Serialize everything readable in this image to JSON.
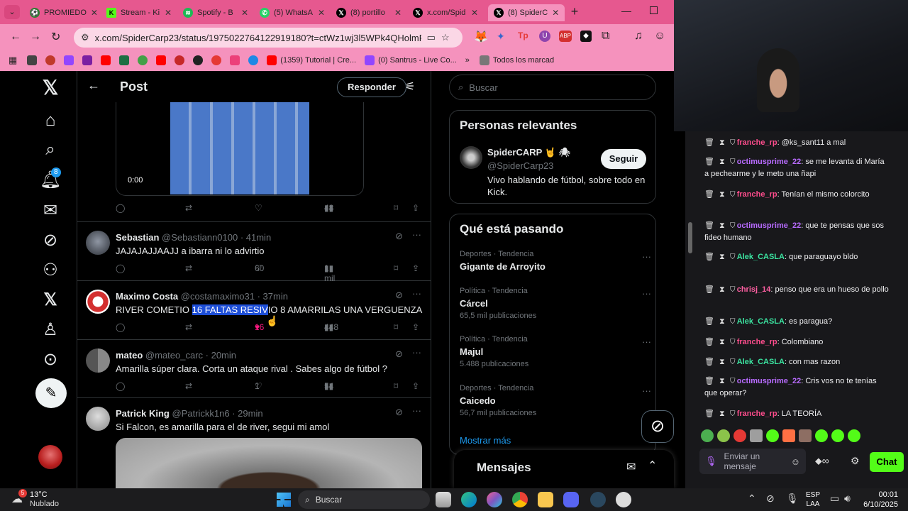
{
  "tabs": [
    {
      "label": "PROMIEDO",
      "color": "#2e7d32",
      "active": false
    },
    {
      "label": "Stream - Ki",
      "color": "#53fc18",
      "active": false
    },
    {
      "label": "Spotify - B",
      "color": "#1db954",
      "active": false
    },
    {
      "label": "(5) WhatsA",
      "color": "#25d366",
      "active": false
    },
    {
      "label": "(8) portillo",
      "color": "#000000",
      "active": false
    },
    {
      "label": "x.com/Spid",
      "color": "#000000",
      "active": false
    },
    {
      "label": "(8) SpiderC",
      "color": "#000000",
      "active": true
    }
  ],
  "url": "x.com/SpiderCarp23/status/1975022764122919180?t=ctWz1wj3l5WPk4QHolmRsg&s=19",
  "bookmarks": {
    "item1": "(1359) Tutorial | Cre...",
    "item2": "(0) Santrus - Live Co...",
    "all": "Todos los marcad"
  },
  "x": {
    "header_title": "Post",
    "reply_button": "Responder",
    "notif_count": "8",
    "video_time": "0:00",
    "video_views": "48",
    "search_placeholder": "Buscar",
    "tweets": [
      {
        "name": "Sebastian",
        "handle": "@Sebastiann0100 · 41min",
        "text": "JAJAJAJJAAJJ a ibarra ni lo advirtio",
        "likes": "60",
        "views": "1 mil"
      },
      {
        "name": "Maximo Costa",
        "handle": "@costamaximo31 · 37min",
        "text_a": "RIVER COMETIO ",
        "text_hl": "16 FALTAS RESIV",
        "text_b": "IO 8 AMARRILAS UNA VERGUENZA",
        "likes": "16",
        "views": "448"
      },
      {
        "name": "mateo",
        "handle": "@mateo_carc · 20min",
        "text": "Amarilla súper clara. Corta un ataque rival . Sabes algo de fútbol ?",
        "likes": "1",
        "views": "54"
      },
      {
        "name": "Patrick King",
        "handle": "@Patrickk1n6 · 29min",
        "text": "Si Falcon, es amarilla para el de river, segui mi amol"
      }
    ],
    "relevant": {
      "title": "Personas relevantes",
      "name": "SpiderCARP",
      "handle": "@SpiderCarp23",
      "follow": "Seguir",
      "bio": "Vivo hablando de fútbol, sobre todo en Kick."
    },
    "trends_title": "Qué está pasando",
    "trends": [
      {
        "cat": "Deportes · Tendencia",
        "name": "Gigante de Arroyito",
        "posts": ""
      },
      {
        "cat": "Política · Tendencia",
        "name": "Cárcel",
        "posts": "65,5 mil publicaciones"
      },
      {
        "cat": "Política · Tendencia",
        "name": "Majul",
        "posts": "5.488 publicaciones"
      },
      {
        "cat": "Deportes · Tendencia",
        "name": "Caicedo",
        "posts": "56,7 mil publicaciones"
      }
    ],
    "show_more": "Mostrar más",
    "messages": "Mensajes"
  },
  "chat": {
    "messages": [
      {
        "user": "franche_rp",
        "color": "#ff4d8d",
        "text": ": @ks_sant11 a mal"
      },
      {
        "user": "octimusprime_22",
        "color": "#b86bff",
        "text": ": se me levanta di María a pechearme y le meto una ñapi"
      },
      {
        "user": "franche_rp",
        "color": "#ff4d8d",
        "text": ": Tenían el mismo colorcito"
      },
      {
        "user": "octimusprime_22",
        "color": "#b86bff",
        "text": ": que te pensas que sos fideo humano"
      },
      {
        "user": "Alek_CASLA",
        "color": "#3be3a0",
        "text": ": que paraguayo bldo"
      },
      {
        "user": "chrisj_14",
        "color": "#ff5fa2",
        "text": ": penso que era un hueso de pollo"
      },
      {
        "user": "Alek_CASLA",
        "color": "#3be3a0",
        "text": ": es paragua?"
      },
      {
        "user": "franche_rp",
        "color": "#ff4d8d",
        "text": ": Colombiano"
      },
      {
        "user": "Alek_CASLA",
        "color": "#3be3a0",
        "text": ": con mas razon"
      },
      {
        "user": "octimusprime_22",
        "color": "#b86bff",
        "text": ": Cris vos no te tenías que operar?"
      },
      {
        "user": "franche_rp",
        "color": "#ff4d8d",
        "text": ": LA TEORÍA"
      }
    ],
    "placeholder": "Enviar un mensaje",
    "send": "Chat"
  },
  "taskbar": {
    "temp": "13°C",
    "weather": "Nublado",
    "weather_badge": "5",
    "search": "Buscar",
    "lang1": "ESP",
    "lang2": "LAA",
    "time": "00:01",
    "date": "6/10/2025"
  }
}
